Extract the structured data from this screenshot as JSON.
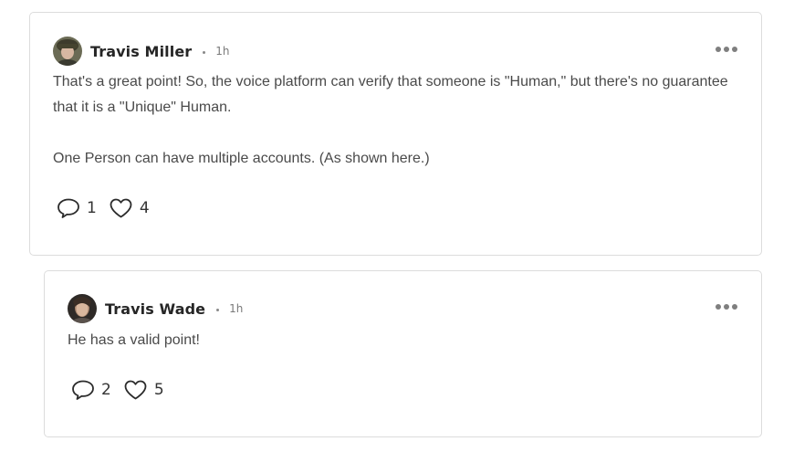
{
  "comments": [
    {
      "author": "Travis Miller",
      "time": "1h",
      "paragraphs": [
        "That's a great point! So, the voice platform can verify that someone is \"Human,\" but there's no guarantee that it is a \"Unique\" Human.",
        "One Person can have multiple accounts. (As shown here.)"
      ],
      "reply_count": "1",
      "like_count": "4",
      "icons": {
        "reply": "comment-bubble-icon",
        "like": "heart-icon",
        "more": "more-options-icon"
      }
    },
    {
      "author": "Travis Wade",
      "time": "1h",
      "paragraphs": [
        "He has a valid point!"
      ],
      "reply_count": "2",
      "like_count": "5",
      "icons": {
        "reply": "comment-bubble-icon",
        "like": "heart-icon",
        "more": "more-options-icon"
      }
    }
  ]
}
